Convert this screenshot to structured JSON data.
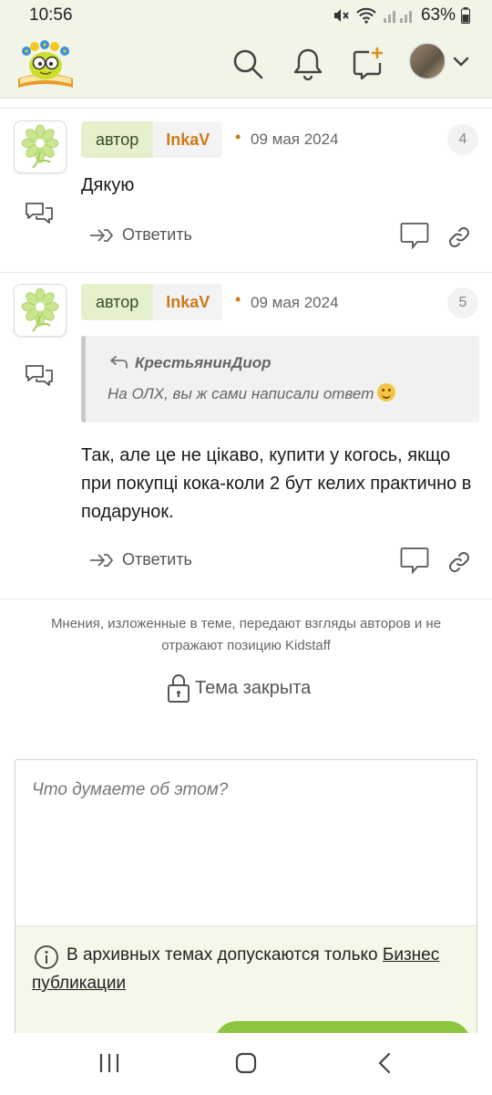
{
  "status_bar": {
    "time": "10:56",
    "battery": "63%"
  },
  "header": {
    "icons": [
      "search-icon",
      "bell-icon",
      "new-message-icon"
    ],
    "avatar": "user-avatar"
  },
  "posts": [
    {
      "role": "автор",
      "author": "InkaV",
      "date": "09 мая 2024",
      "number": "4",
      "body": "Дякую",
      "reply_label": "Ответить"
    },
    {
      "role": "автор",
      "author": "InkaV",
      "date": "09 мая 2024",
      "number": "5",
      "quote": {
        "author": "КрестьянинДиор",
        "text": "На ОЛХ, вы ж сами написали ответ"
      },
      "body": "Так, але це не цікаво, купити у когось, якщо при покупці кока-коли 2 бут келих практично в подарунок.",
      "reply_label": "Ответить"
    }
  ],
  "disclaimer": "Мнения, изложенные в теме, передают взгляды авторов и не отражают позицию Kidstaff",
  "closed_label": "Тема закрыта",
  "composer": {
    "placeholder": "Что думаете об этом?",
    "archive_note_prefix": "В архивных темах допускаются только ",
    "archive_note_link": "Бизнес публикации"
  },
  "colors": {
    "accent": "#8cc63e",
    "author_name": "#cc7a1a",
    "header_bg": "#f1f5e8"
  }
}
